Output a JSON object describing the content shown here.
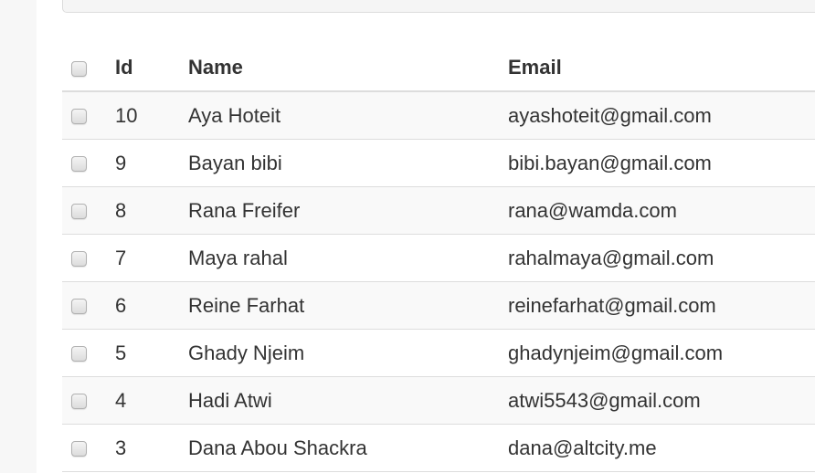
{
  "table": {
    "headers": {
      "id": "Id",
      "name": "Name",
      "email": "Email"
    },
    "rows": [
      {
        "id": "10",
        "name": "Aya Hoteit",
        "email": "ayashoteit@gmail.com"
      },
      {
        "id": "9",
        "name": "Bayan bibi",
        "email": "bibi.bayan@gmail.com"
      },
      {
        "id": "8",
        "name": "Rana Freifer",
        "email": "rana@wamda.com"
      },
      {
        "id": "7",
        "name": "Maya rahal",
        "email": "rahalmaya@gmail.com"
      },
      {
        "id": "6",
        "name": "Reine Farhat",
        "email": "reinefarhat@gmail.com"
      },
      {
        "id": "5",
        "name": "Ghady Njeim",
        "email": "ghadynjeim@gmail.com"
      },
      {
        "id": "4",
        "name": "Hadi Atwi",
        "email": "atwi5543@gmail.com"
      },
      {
        "id": "3",
        "name": "Dana Abou Shackra",
        "email": "dana@altcity.me"
      }
    ]
  }
}
